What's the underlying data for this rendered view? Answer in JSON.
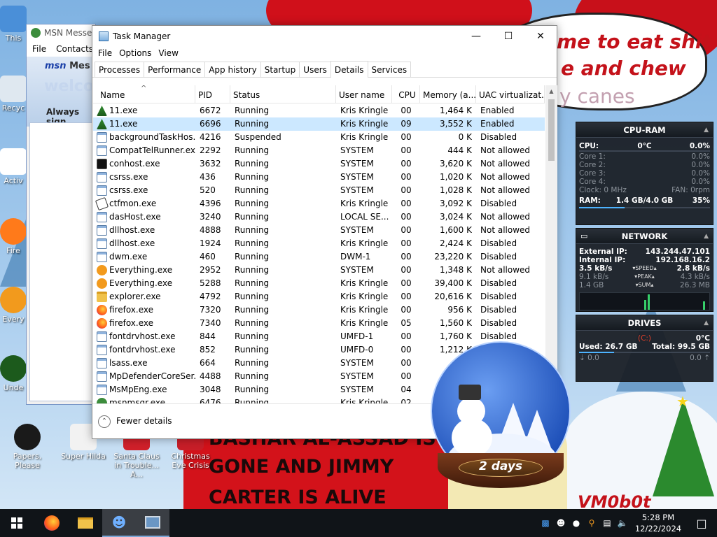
{
  "desktop": {
    "speech_bubble": [
      "me to eat shit",
      "e and chew",
      "y canes"
    ],
    "banner_text": [
      "BASHAR AL-ASSAD IS",
      "GONE AND JIMMY",
      "CARTER IS ALIVE"
    ],
    "signature": "VM0b0t",
    "globe_label": "2 days",
    "icons": [
      {
        "label": "This",
        "name": "this-pc"
      },
      {
        "label": "Recyc",
        "name": "recycle-bin"
      },
      {
        "label": "Activ",
        "name": "activision"
      },
      {
        "label": "Fire",
        "name": "firefox"
      },
      {
        "label": "Every",
        "name": "everything"
      },
      {
        "label": "Unde",
        "name": "undertale"
      },
      {
        "label": "Papers, Please",
        "name": "papers-please"
      },
      {
        "label": "Super Hilda",
        "name": "super-hilda"
      },
      {
        "label": "Santa Claus in Trouble... A...",
        "name": "santa-claus-in-trouble"
      },
      {
        "label": "Christmas Eve Crisis",
        "name": "christmas-eve-crisis"
      }
    ]
  },
  "msn": {
    "title": "MSN Messe",
    "menu": [
      "File",
      "Contacts"
    ],
    "logo": "msn",
    "logo_suffix": "Mes",
    "welcome": "welcom",
    "always_sign": "Always sign"
  },
  "taskmanager": {
    "title": "Task Manager",
    "menu": [
      "File",
      "Options",
      "View"
    ],
    "tabs": [
      "Processes",
      "Performance",
      "App history",
      "Startup",
      "Users",
      "Details",
      "Services"
    ],
    "active_tab": "Details",
    "columns": [
      "Name",
      "PID",
      "Status",
      "User name",
      "CPU",
      "Memory (a...",
      "UAC virtualizat..."
    ],
    "rows": [
      {
        "name": "11.exe",
        "pid": "6672",
        "status": "Running",
        "user": "Kris Kringle",
        "cpu": "00",
        "mem": "1,464 K",
        "uac": "Enabled",
        "icon": "tree"
      },
      {
        "name": "11.exe",
        "pid": "6696",
        "status": "Running",
        "user": "Kris Kringle",
        "cpu": "09",
        "mem": "3,552 K",
        "uac": "Enabled",
        "icon": "tree",
        "selected": true
      },
      {
        "name": "backgroundTaskHos...",
        "pid": "4216",
        "status": "Suspended",
        "user": "Kris Kringle",
        "cpu": "00",
        "mem": "0 K",
        "uac": "Disabled",
        "icon": "window"
      },
      {
        "name": "CompatTelRunner.exe",
        "pid": "2292",
        "status": "Running",
        "user": "SYSTEM",
        "cpu": "00",
        "mem": "444 K",
        "uac": "Not allowed",
        "icon": "window"
      },
      {
        "name": "conhost.exe",
        "pid": "3632",
        "status": "Running",
        "user": "SYSTEM",
        "cpu": "00",
        "mem": "3,620 K",
        "uac": "Not allowed",
        "icon": "console"
      },
      {
        "name": "csrss.exe",
        "pid": "436",
        "status": "Running",
        "user": "SYSTEM",
        "cpu": "00",
        "mem": "1,020 K",
        "uac": "Not allowed",
        "icon": "window"
      },
      {
        "name": "csrss.exe",
        "pid": "520",
        "status": "Running",
        "user": "SYSTEM",
        "cpu": "00",
        "mem": "1,028 K",
        "uac": "Not allowed",
        "icon": "window"
      },
      {
        "name": "ctfmon.exe",
        "pid": "4396",
        "status": "Running",
        "user": "Kris Kringle",
        "cpu": "00",
        "mem": "3,092 K",
        "uac": "Disabled",
        "icon": "pen"
      },
      {
        "name": "dasHost.exe",
        "pid": "3240",
        "status": "Running",
        "user": "LOCAL SE...",
        "cpu": "00",
        "mem": "3,024 K",
        "uac": "Not allowed",
        "icon": "window"
      },
      {
        "name": "dllhost.exe",
        "pid": "4888",
        "status": "Running",
        "user": "SYSTEM",
        "cpu": "00",
        "mem": "1,600 K",
        "uac": "Not allowed",
        "icon": "window"
      },
      {
        "name": "dllhost.exe",
        "pid": "1924",
        "status": "Running",
        "user": "Kris Kringle",
        "cpu": "00",
        "mem": "2,424 K",
        "uac": "Disabled",
        "icon": "window"
      },
      {
        "name": "dwm.exe",
        "pid": "460",
        "status": "Running",
        "user": "DWM-1",
        "cpu": "00",
        "mem": "23,220 K",
        "uac": "Disabled",
        "icon": "window"
      },
      {
        "name": "Everything.exe",
        "pid": "2952",
        "status": "Running",
        "user": "SYSTEM",
        "cpu": "00",
        "mem": "1,348 K",
        "uac": "Not allowed",
        "icon": "magnifier"
      },
      {
        "name": "Everything.exe",
        "pid": "5288",
        "status": "Running",
        "user": "Kris Kringle",
        "cpu": "00",
        "mem": "39,400 K",
        "uac": "Disabled",
        "icon": "magnifier"
      },
      {
        "name": "explorer.exe",
        "pid": "4792",
        "status": "Running",
        "user": "Kris Kringle",
        "cpu": "00",
        "mem": "20,616 K",
        "uac": "Disabled",
        "icon": "folder"
      },
      {
        "name": "firefox.exe",
        "pid": "7320",
        "status": "Running",
        "user": "Kris Kringle",
        "cpu": "00",
        "mem": "956 K",
        "uac": "Disabled",
        "icon": "firefox"
      },
      {
        "name": "firefox.exe",
        "pid": "7340",
        "status": "Running",
        "user": "Kris Kringle",
        "cpu": "05",
        "mem": "1,560 K",
        "uac": "Disabled",
        "icon": "firefox"
      },
      {
        "name": "fontdrvhost.exe",
        "pid": "844",
        "status": "Running",
        "user": "UMFD-1",
        "cpu": "00",
        "mem": "1,760 K",
        "uac": "Disabled",
        "icon": "window"
      },
      {
        "name": "fontdrvhost.exe",
        "pid": "852",
        "status": "Running",
        "user": "UMFD-0",
        "cpu": "00",
        "mem": "1,212 K",
        "uac": "Disabled",
        "icon": "window"
      },
      {
        "name": "lsass.exe",
        "pid": "664",
        "status": "Running",
        "user": "SYSTEM",
        "cpu": "00",
        "mem": "4...",
        "uac": "",
        "icon": "window"
      },
      {
        "name": "MpDefenderCoreSer...",
        "pid": "4488",
        "status": "Running",
        "user": "SYSTEM",
        "cpu": "00",
        "mem": "",
        "uac": "",
        "icon": "window"
      },
      {
        "name": "MsMpEng.exe",
        "pid": "3048",
        "status": "Running",
        "user": "SYSTEM",
        "cpu": "04",
        "mem": "",
        "uac": "",
        "icon": "window"
      },
      {
        "name": "msnmsgr.exe",
        "pid": "6476",
        "status": "Running",
        "user": "Kris Kringle",
        "cpu": "02",
        "mem": "",
        "uac": "",
        "icon": "msn"
      }
    ],
    "footer": "Fewer details"
  },
  "gadgets": {
    "cpu_ram": {
      "title": "CPU-RAM",
      "cpu_label": "CPU:",
      "cpu_temp": "0°C",
      "cpu_pct": "0.0%",
      "cores": [
        {
          "label": "Core 1:",
          "value": "0.0%"
        },
        {
          "label": "Core 2:",
          "value": "0.0%"
        },
        {
          "label": "Core 3:",
          "value": "0.0%"
        },
        {
          "label": "Core 4:",
          "value": "0.0%"
        }
      ],
      "clock": "Clock: 0 MHz",
      "fan": "FAN: 0rpm",
      "ram_label": "RAM:",
      "ram_used": "1.4 GB/4.0 GB",
      "ram_pct": "35%",
      "ram_fraction": 0.35
    },
    "network": {
      "title": "NETWORK",
      "external_label": "External IP:",
      "external_ip": "143.244.47.101",
      "internal_label": "Internal IP:",
      "internal_ip": "192.168.16.2",
      "speed_down": "3.5 kB/s",
      "speed_label": "SPEED",
      "speed_up": "2.8 kB/s",
      "peak_down": "9.1 kB/s",
      "peak_label": "PEAK",
      "peak_up": "4.3 kB/s",
      "sum_down": "1.4 GB",
      "sum_label": "SUM",
      "sum_up": "26.3 MB"
    },
    "drives": {
      "title": "DRIVES",
      "drive": "(C:)",
      "temp": "0°C",
      "used": "Used: 26.7 GB",
      "total": "Total: 99.5 GB",
      "read": "0.0",
      "write": "0.0",
      "used_fraction": 0.27
    }
  },
  "taskbar": {
    "time": "5:28 PM",
    "date": "12/22/2024",
    "apps": [
      "start",
      "firefox",
      "file-explorer",
      "msn-messenger",
      "task-manager"
    ]
  }
}
